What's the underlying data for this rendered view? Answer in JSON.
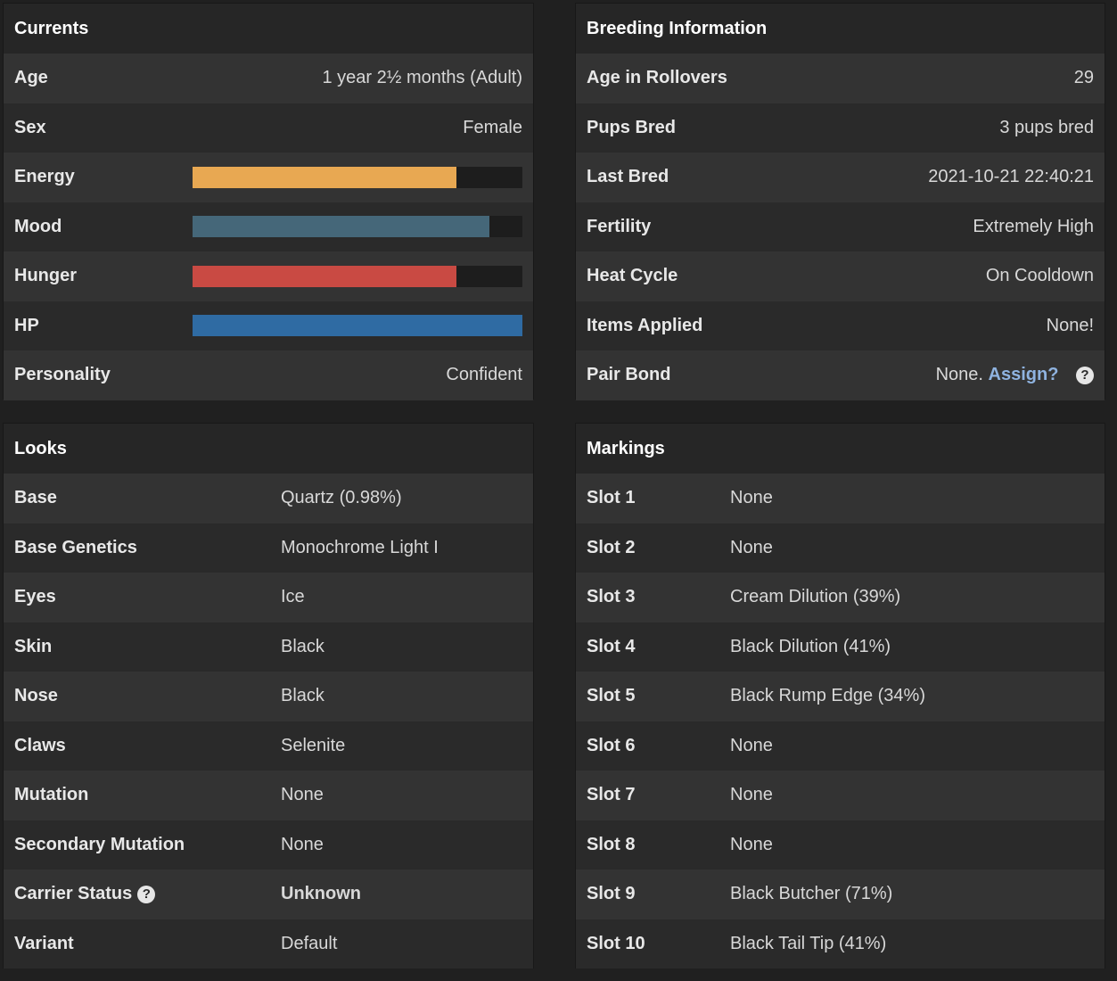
{
  "currents": {
    "title": "Currents",
    "age": {
      "label": "Age",
      "value": "1 year 2½ months (Adult)"
    },
    "sex": {
      "label": "Sex",
      "value": "Female"
    },
    "energy": {
      "label": "Energy",
      "level": 0.8,
      "color": "#e8a852"
    },
    "mood": {
      "label": "Mood",
      "level": 0.9,
      "color": "#456779"
    },
    "hunger": {
      "label": "Hunger",
      "level": 0.8,
      "color": "#c94a43"
    },
    "hp": {
      "label": "HP",
      "level": 1.0,
      "color": "#2f6ba3"
    },
    "personality": {
      "label": "Personality",
      "value": "Confident"
    }
  },
  "breeding": {
    "title": "Breeding Information",
    "age_rollovers": {
      "label": "Age in Rollovers",
      "value": "29"
    },
    "pups_bred": {
      "label": "Pups Bred",
      "value": "3 pups bred"
    },
    "last_bred": {
      "label": "Last Bred",
      "value": "2021-10-21 22:40:21"
    },
    "fertility": {
      "label": "Fertility",
      "value": "Extremely High"
    },
    "heat_cycle": {
      "label": "Heat Cycle",
      "value": "On Cooldown"
    },
    "items_applied": {
      "label": "Items Applied",
      "value": "None!"
    },
    "pair_bond": {
      "label": "Pair Bond",
      "value": "None.",
      "link": "Assign?",
      "icon": "question-circle-icon"
    }
  },
  "looks": {
    "title": "Looks",
    "rows": [
      {
        "label": "Base",
        "value": "Quartz (0.98%)"
      },
      {
        "label": "Base Genetics",
        "value": "Monochrome Light I"
      },
      {
        "label": "Eyes",
        "value": "Ice"
      },
      {
        "label": "Skin",
        "value": "Black"
      },
      {
        "label": "Nose",
        "value": "Black"
      },
      {
        "label": "Claws",
        "value": "Selenite"
      },
      {
        "label": "Mutation",
        "value": "None"
      },
      {
        "label": "Secondary Mutation",
        "value": "None"
      },
      {
        "label": "Carrier Status",
        "value": "Unknown",
        "icon": "question-circle-icon"
      },
      {
        "label": "Variant",
        "value": "Default"
      }
    ]
  },
  "markings": {
    "title": "Markings",
    "rows": [
      {
        "label": "Slot 1",
        "value": "None"
      },
      {
        "label": "Slot 2",
        "value": "None"
      },
      {
        "label": "Slot 3",
        "value": "Cream Dilution (39%)"
      },
      {
        "label": "Slot 4",
        "value": "Black Dilution (41%)"
      },
      {
        "label": "Slot 5",
        "value": "Black Rump Edge (34%)"
      },
      {
        "label": "Slot 6",
        "value": "None"
      },
      {
        "label": "Slot 7",
        "value": "None"
      },
      {
        "label": "Slot 8",
        "value": "None"
      },
      {
        "label": "Slot 9",
        "value": "Black Butcher (71%)"
      },
      {
        "label": "Slot 10",
        "value": "Black Tail Tip (41%)"
      }
    ]
  }
}
